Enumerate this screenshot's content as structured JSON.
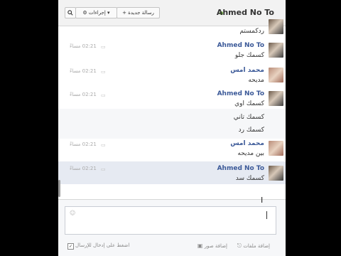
{
  "header": {
    "title": "Ahmed No To",
    "new_message_label": "+ رسالة جديدة",
    "actions_label": "⚙ إجراءات ▾",
    "search_icon": "search-icon"
  },
  "messages": [
    {
      "name": "",
      "text": "ردكمستم",
      "time": "",
      "avatar": "ahmed"
    },
    {
      "name": "Ahmed No To",
      "text": "كسمك جلو",
      "time": "02:21 مساءً",
      "avatar": "ahmed"
    },
    {
      "name": "محمد امس",
      "text": "مديحه",
      "time": "02:21 مساءً",
      "avatar": "mohamed"
    },
    {
      "name": "Ahmed No To",
      "text": "كسمك اوي",
      "time": "02:21 مساءً",
      "avatar": "ahmed"
    },
    {
      "name": "",
      "text": "كسمك تاني",
      "time": "",
      "avatar": ""
    },
    {
      "name": "",
      "text": "كسمك رد",
      "time": "",
      "avatar": ""
    },
    {
      "name": "محمد امس",
      "text": "بين مديحه",
      "time": "02:21 مساءً",
      "avatar": "mohamed"
    },
    {
      "name": "Ahmed No To",
      "text": "كسمك سد",
      "time": "02:21 مساءً",
      "avatar": "ahmed"
    }
  ],
  "composer": {
    "placeholder": "",
    "add_files_label": "إضافة ملفات",
    "add_photo_label": "إضافة صور",
    "enter_to_send_label": "اضغط على إدخال للإرسال",
    "enter_to_send_checked": true
  }
}
